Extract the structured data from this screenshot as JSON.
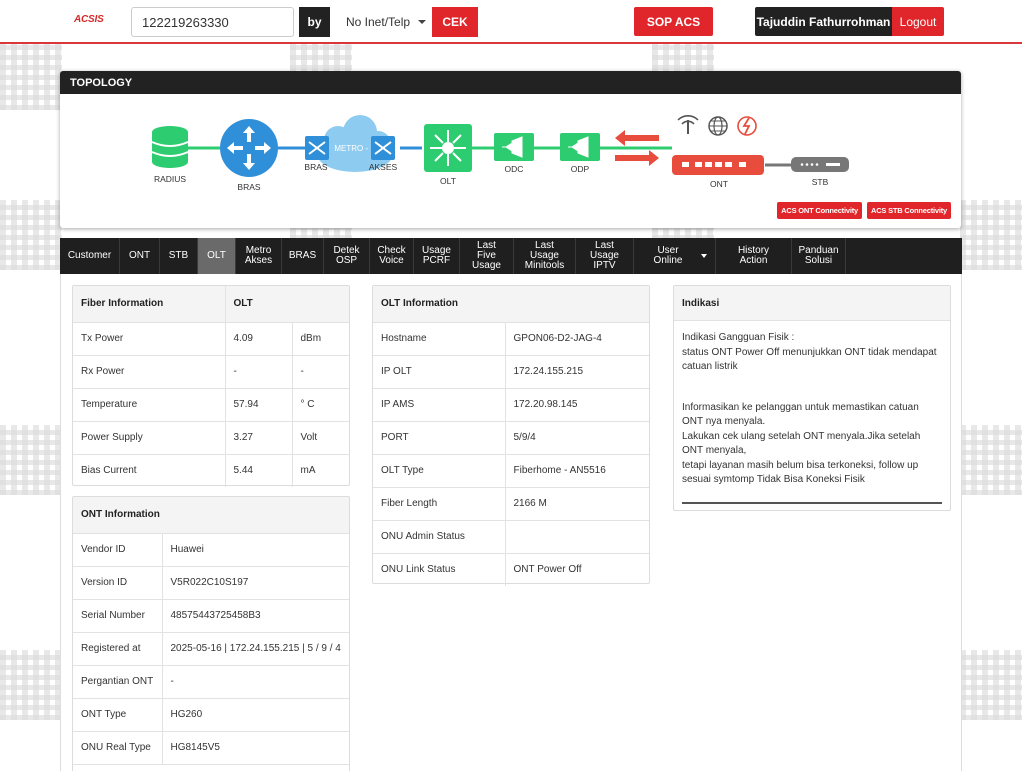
{
  "header": {
    "logo_text": "ACSIS",
    "logo_sub": "",
    "search_value": "122219263330",
    "by_label": "by",
    "type_selected": "No Inet/Telp",
    "cek_label": "CEK",
    "sop_label": "SOP ACS",
    "user_name": "Tajuddin Fathurrohman",
    "logout_label": "Logout"
  },
  "topology": {
    "title": "TOPOLOGY",
    "nodes": {
      "radius": "RADIUS",
      "bras": "BRAS",
      "bras2": "BRAS",
      "metro": "METRO - E",
      "akses": "AKSES",
      "olt": "OLT",
      "odc": "ODC",
      "odp": "ODP",
      "ont": "ONT",
      "stb": "STB"
    },
    "acs_ont_label": "ACS ONT Connectivity",
    "acs_stb_label": "ACS STB Connectivity",
    "colors": {
      "green": "#2ecc71",
      "blue": "#2f8fd8",
      "red": "#e74c3c",
      "gray": "#666666"
    }
  },
  "tabs": [
    {
      "label": "Customer"
    },
    {
      "label": "ONT"
    },
    {
      "label": "STB"
    },
    {
      "label": "OLT",
      "active": true
    },
    {
      "label": "Metro Akses"
    },
    {
      "label": "BRAS"
    },
    {
      "label": "Detek OSP"
    },
    {
      "label": "Check Voice"
    },
    {
      "label": "Usage PCRF"
    },
    {
      "label": "Last Five Usage"
    },
    {
      "label": "Last Usage Minitools"
    },
    {
      "label": "Last Usage IPTV"
    },
    {
      "label": "User Online",
      "dropdown": true
    },
    {
      "label": "History Action"
    },
    {
      "label": "Panduan Solusi"
    }
  ],
  "fiber": {
    "header": "Fiber Information",
    "header_value": "OLT",
    "rows": [
      {
        "label": "Tx Power",
        "value": "4.09",
        "unit": "dBm"
      },
      {
        "label": "Rx Power",
        "value": "-",
        "unit": "-"
      },
      {
        "label": "Temperature",
        "value": "57.94",
        "unit": "° C"
      },
      {
        "label": "Power Supply",
        "value": "3.27",
        "unit": "Volt"
      },
      {
        "label": "Bias Current",
        "value": "5.44",
        "unit": "mA"
      }
    ]
  },
  "ont_info": {
    "header": "ONT Information",
    "rows": [
      {
        "label": "Vendor ID",
        "value": "Huawei"
      },
      {
        "label": "Version ID",
        "value": "V5R022C10S197"
      },
      {
        "label": "Serial Number",
        "value": "48575443725458B3"
      },
      {
        "label": "Registered at",
        "value": "2025-05-16 | 172.24.155.215 | 5 / 9 / 4"
      },
      {
        "label": "Pergantian ONT",
        "value": "-"
      },
      {
        "label": "ONT Type",
        "value": "HG260"
      },
      {
        "label": "ONU Real Type",
        "value": "HG8145V5"
      }
    ]
  },
  "olt_info": {
    "header": "OLT Information",
    "rows": [
      {
        "label": "Hostname",
        "value": "GPON06-D2-JAG-4"
      },
      {
        "label": "IP OLT",
        "value": "172.24.155.215"
      },
      {
        "label": "IP AMS",
        "value": "172.20.98.145"
      },
      {
        "label": "PORT",
        "value": "5/9/4"
      },
      {
        "label": "OLT Type",
        "value": "Fiberhome - AN5516"
      },
      {
        "label": "Fiber Length",
        "value": "2166 M"
      },
      {
        "label": "ONU Admin Status",
        "value": ""
      },
      {
        "label": "ONU Link Status",
        "value": "ONT Power Off"
      }
    ]
  },
  "indikasi": {
    "header": "Indikasi",
    "line1": "Indikasi Gangguan Fisik :",
    "line2": "status ONT Power Off menunjukkan ONT tidak mendapat catuan listrik",
    "line3": "Informasikan ke pelanggan untuk memastikan catuan ONT nya menyala.",
    "line4": "Lakukan cek ulang setelah ONT menyala.Jika setelah ONT menyala,",
    "line5": "tetapi layanan masih belum bisa terkoneksi, follow up sesuai symtomp Tidak Bisa Koneksi Fisik"
  }
}
